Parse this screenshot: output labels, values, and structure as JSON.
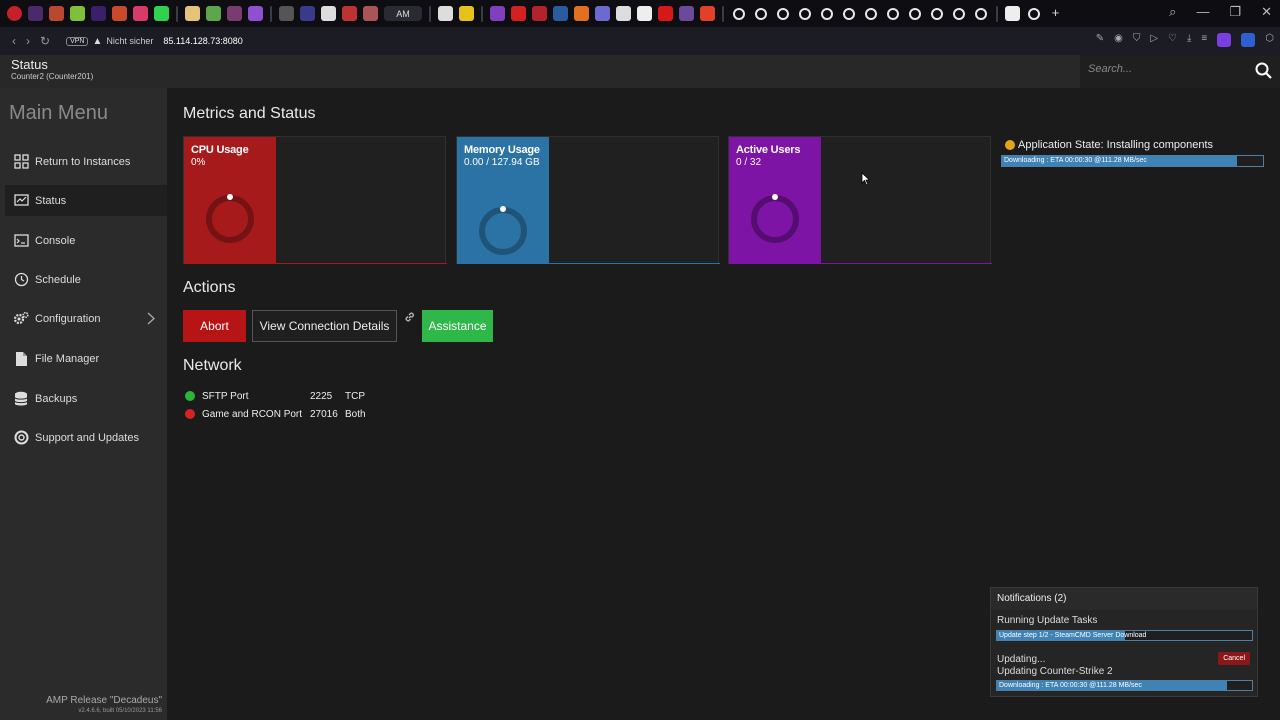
{
  "browser": {
    "active_tab_label": "AM",
    "vpn_label": "VPN",
    "security_label": "Nicht sicher",
    "url": "85.114.128.73:8080"
  },
  "header": {
    "title": "Status",
    "subtitle": "Counter2 (Counter201)",
    "search_placeholder": "Search..."
  },
  "sidebar": {
    "title": "Main Menu",
    "items": [
      {
        "label": "Return to Instances"
      },
      {
        "label": "Status"
      },
      {
        "label": "Console"
      },
      {
        "label": "Schedule"
      },
      {
        "label": "Configuration"
      },
      {
        "label": "File Manager"
      },
      {
        "label": "Backups"
      },
      {
        "label": "Support and Updates"
      }
    ],
    "release": "AMP Release \"Decadeus\"",
    "build": "v2.4.6.6, built 05/10/2023 11:56"
  },
  "metrics": {
    "heading": "Metrics and Status",
    "cards": [
      {
        "label": "CPU Usage",
        "value": "0%",
        "color": "#a71a1c"
      },
      {
        "label": "Memory Usage",
        "value": "0.00 / 127.94 GB",
        "color": "#2b73a4"
      },
      {
        "label": "Active Users",
        "value": "0 / 32",
        "color": "#7e14a6"
      }
    ],
    "app_state": "Application State: Installing components",
    "download_text": "Downloading : ETA 00:00:30 @111.28 MB/sec",
    "download_progress": 0.9
  },
  "actions": {
    "heading": "Actions",
    "abort": "Abort",
    "view_connection": "View Connection Details",
    "assistance": "Assistance"
  },
  "network": {
    "heading": "Network",
    "ports": [
      {
        "name": "SFTP Port",
        "port": "2225",
        "protocol": "TCP",
        "status_color": "#27b53a"
      },
      {
        "name": "Game and RCON Port",
        "port": "27016",
        "protocol": "Both",
        "status_color": "#d62222"
      }
    ]
  },
  "notifications": {
    "header": "Notifications (2)",
    "task1_title": "Running Update Tasks",
    "task1_bar_text": "Update step 1/2 - SteamCMD Server Download",
    "task1_progress": 0.5,
    "task2_line1": "Updating...",
    "task2_line2": "Updating Counter-Strike 2",
    "task2_bar_text": "Downloading : ETA 00:00:30 @111.28 MB/sec",
    "task2_progress": 0.9,
    "cancel": "Cancel"
  }
}
